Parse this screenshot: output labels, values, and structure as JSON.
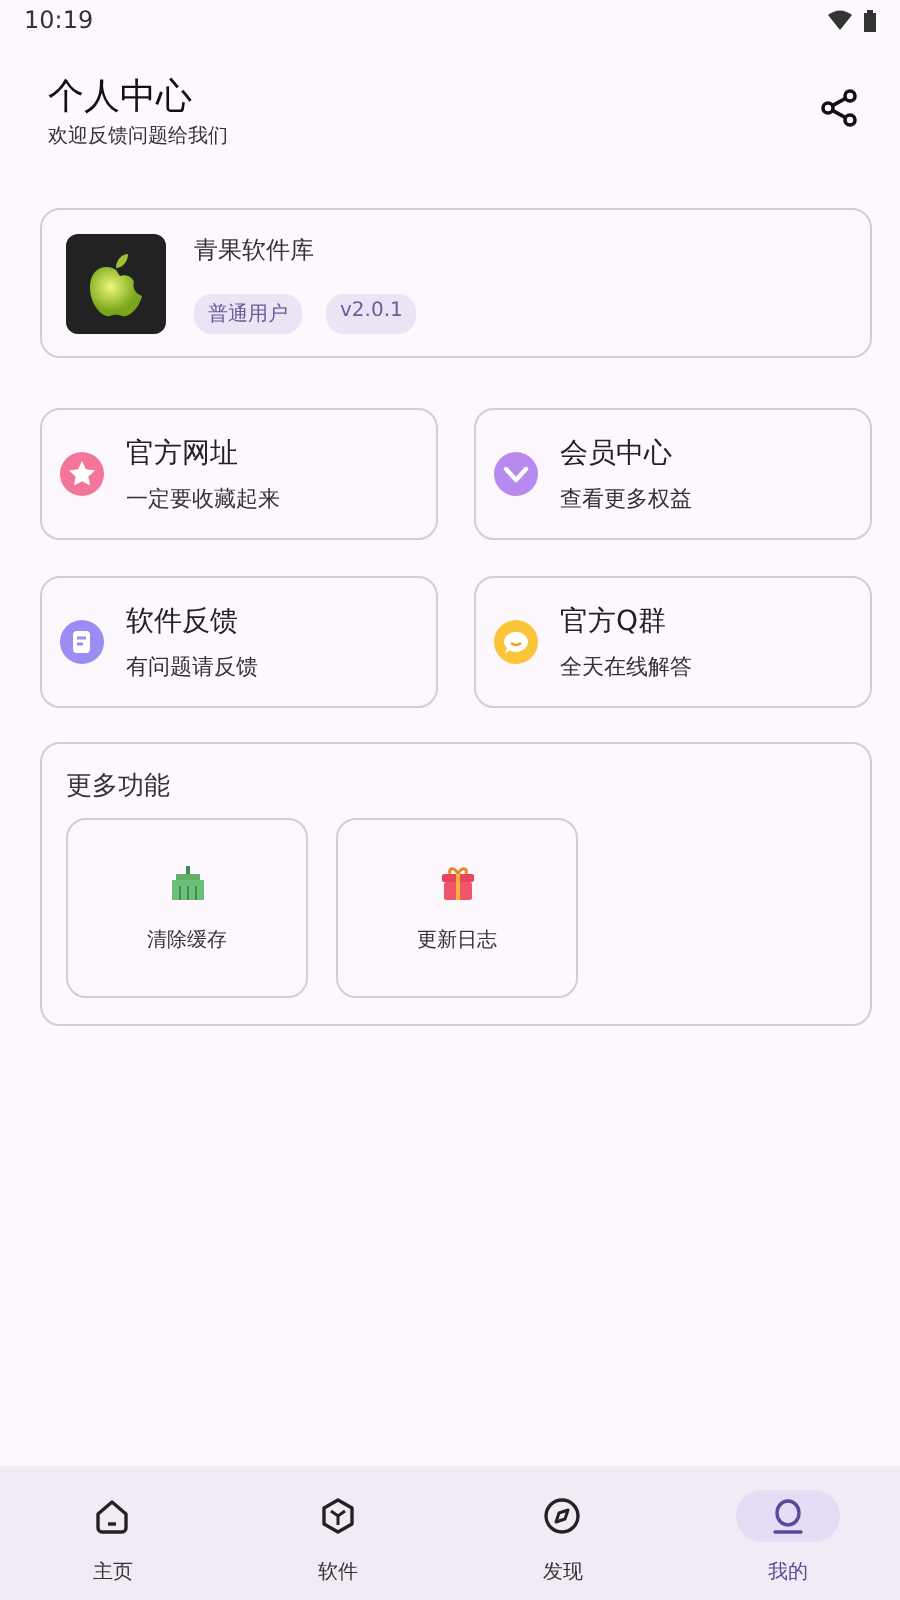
{
  "status_bar": {
    "time": "10:19"
  },
  "header": {
    "title": "个人中心",
    "subtitle": "欢迎反馈问题给我们"
  },
  "profile": {
    "name": "青果软件库",
    "tags": [
      "普通用户",
      "v2.0.1"
    ]
  },
  "shortcuts": [
    {
      "title": "官方网址",
      "subtitle": "一定要收藏起来"
    },
    {
      "title": "会员中心",
      "subtitle": "查看更多权益"
    },
    {
      "title": "软件反馈",
      "subtitle": "有问题请反馈"
    },
    {
      "title": "官方Q群",
      "subtitle": "全天在线解答"
    }
  ],
  "more": {
    "title": "更多功能",
    "items": [
      {
        "label": "清除缓存"
      },
      {
        "label": "更新日志"
      }
    ]
  },
  "nav": [
    {
      "label": "主页",
      "selected": false
    },
    {
      "label": "软件",
      "selected": false
    },
    {
      "label": "发现",
      "selected": false
    },
    {
      "label": "我的",
      "selected": true
    }
  ]
}
